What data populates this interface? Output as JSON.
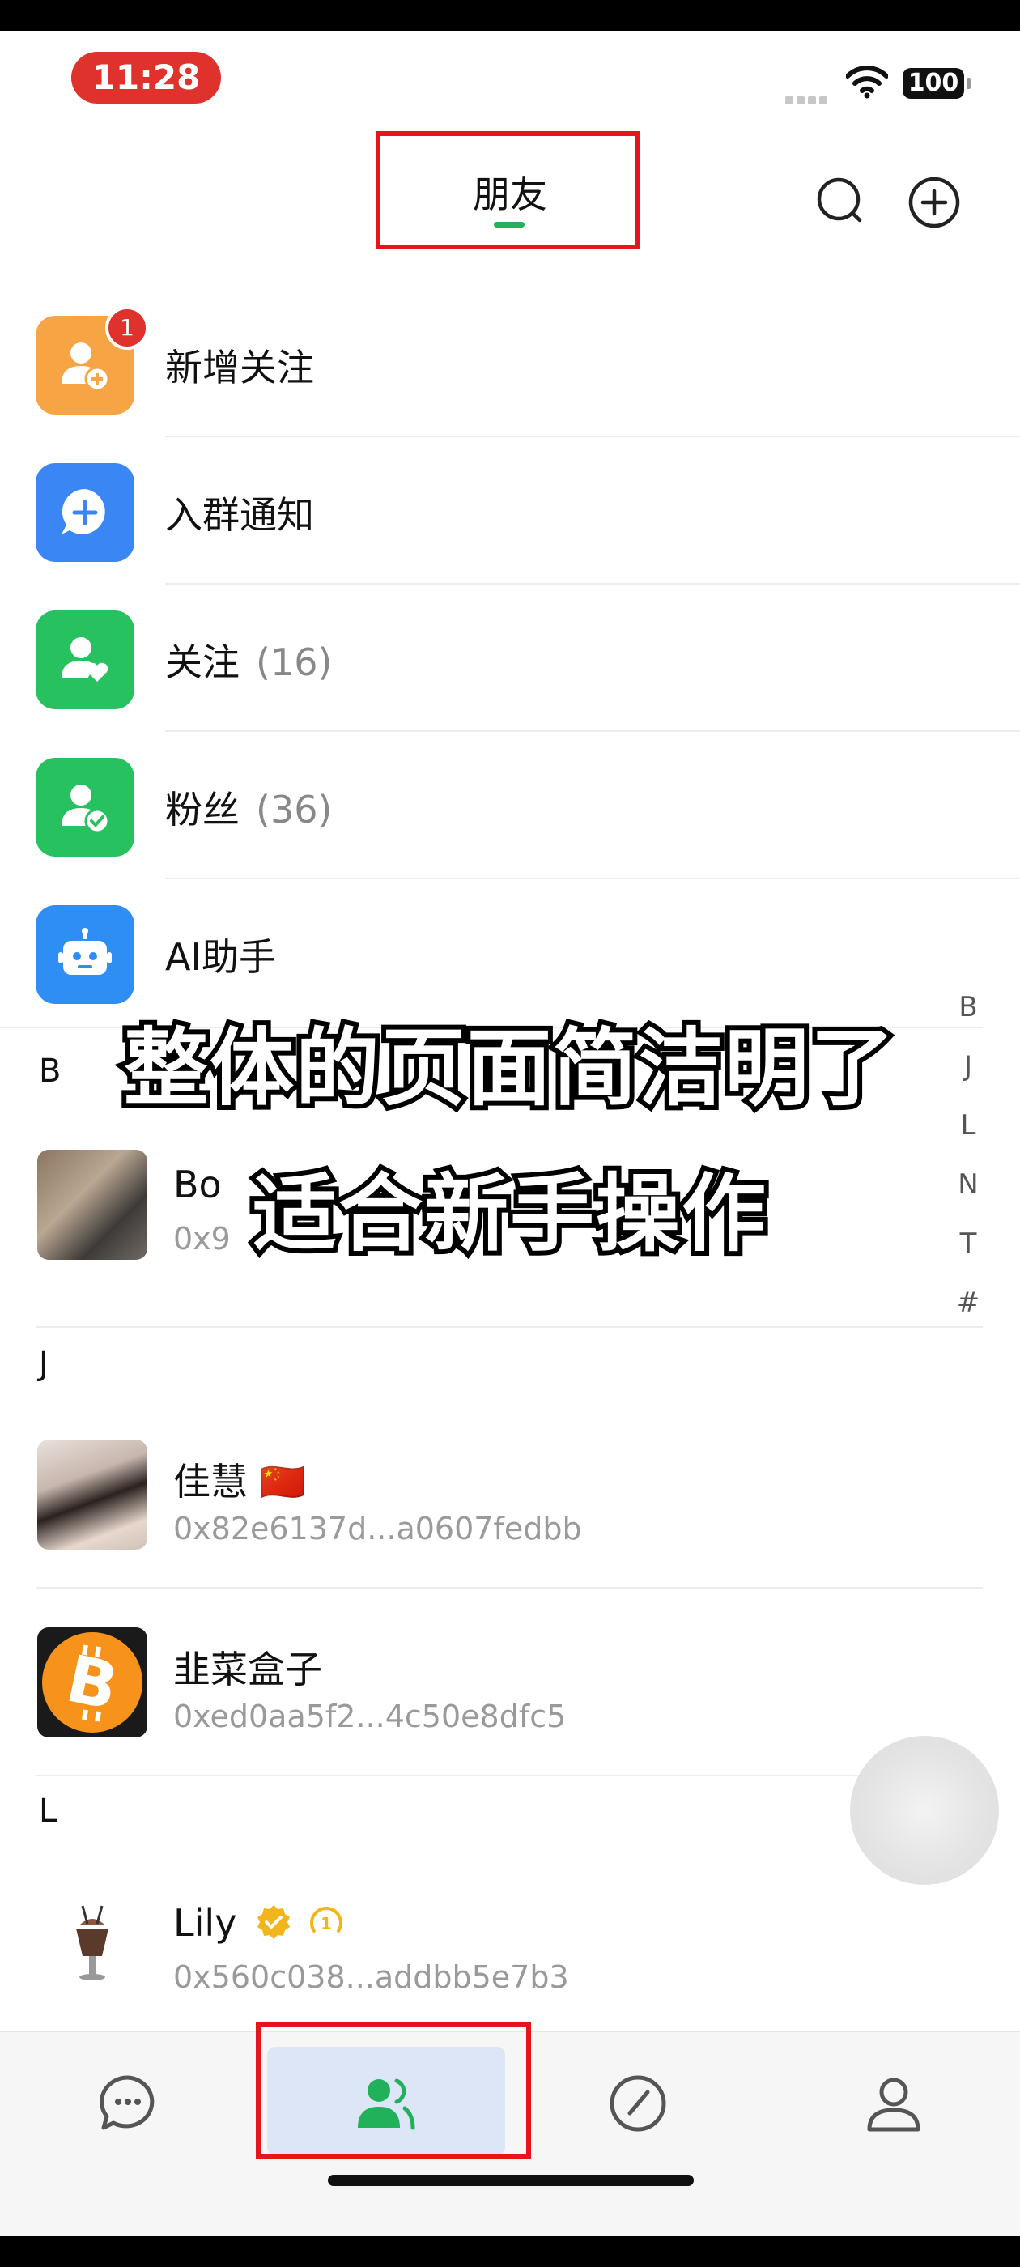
{
  "status_bar": {
    "time": "11:28",
    "battery": "100"
  },
  "header": {
    "title": "朋友"
  },
  "menu": [
    {
      "label": "新增关注",
      "count": "",
      "badge": "1",
      "color": "#f7a444",
      "icon": "add-user-icon"
    },
    {
      "label": "入群通知",
      "count": "",
      "badge": "",
      "color": "#3b86f5",
      "icon": "chat-plus-icon"
    },
    {
      "label": "关注",
      "count": "(16)",
      "badge": "",
      "color": "#27c25f",
      "icon": "user-heart-icon"
    },
    {
      "label": "粉丝",
      "count": "(36)",
      "badge": "",
      "color": "#27c25f",
      "icon": "user-check-icon"
    },
    {
      "label": "AI助手",
      "count": "",
      "badge": "",
      "color": "#2f8ef4",
      "icon": "robot-icon"
    }
  ],
  "sections": {
    "b": {
      "letter": "B",
      "contacts": [
        {
          "name": "Bo",
          "address": "0x9"
        }
      ]
    },
    "j": {
      "letter": "J",
      "contacts": [
        {
          "name": "佳慧",
          "flag": "🇨🇳",
          "address": "0x82e6137d...a0607fedbb"
        },
        {
          "name": "韭菜盒子",
          "address": "0xed0aa5f2...4c50e8dfc5"
        }
      ]
    },
    "l": {
      "letter": "L",
      "contacts": [
        {
          "name": "Lily",
          "address": "0x560c038...addbb5e7b3"
        }
      ]
    }
  },
  "index_letters": [
    "B",
    "J",
    "L",
    "N",
    "T",
    "#"
  ],
  "caption": {
    "line1": "整体的页面简洁明了",
    "line2": "适合新手操作"
  },
  "tabs": [
    "chat-icon",
    "friends-icon",
    "discover-icon",
    "profile-icon"
  ],
  "colors": {
    "accent_green": "#21b15b",
    "highlight_red": "#e5151b",
    "active_tab_bg": "#dce6f6"
  }
}
